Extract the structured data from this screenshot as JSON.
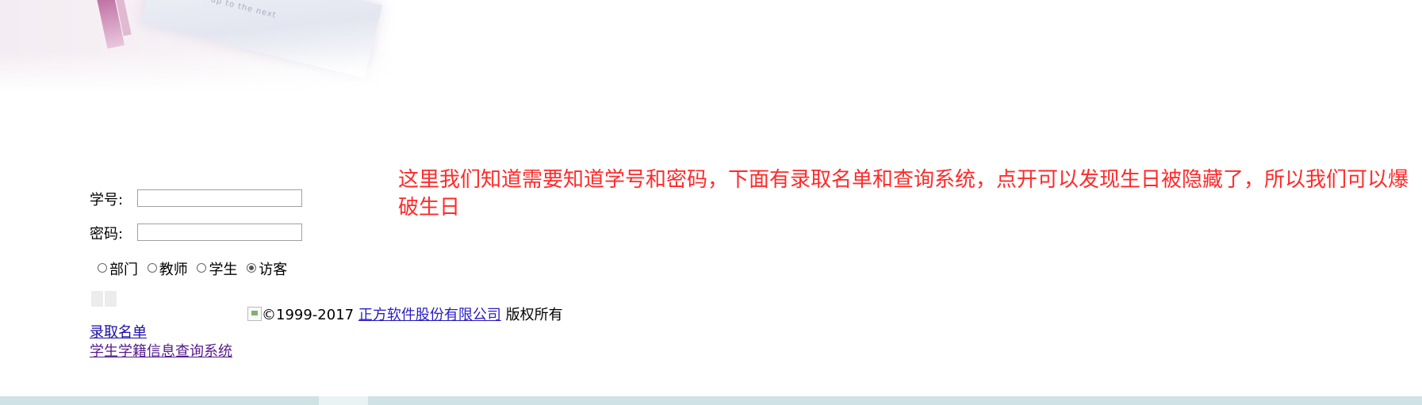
{
  "login": {
    "id_label": "学号:",
    "id_value": "",
    "password_label": "密码:",
    "password_value": "",
    "roles": [
      {
        "label": "部门",
        "selected": false
      },
      {
        "label": "教师",
        "selected": false
      },
      {
        "label": "学生",
        "selected": false
      },
      {
        "label": "访客",
        "selected": true
      }
    ]
  },
  "annotation": "这里我们知道需要知道学号和密码，下面有录取名单和查询系统，点开可以发现生日被隐藏了，所以我们可以爆破生日",
  "footer": {
    "copyright": "©1999-2017 ",
    "company_link": "正方软件股份有限公司",
    "rights": " 版权所有"
  },
  "links": {
    "admission_list": "录取名单",
    "student_info_system": "学生学籍信息查询系统"
  },
  "banner": {
    "paper_text": "...and up to the next"
  },
  "colors": {
    "annotation": "#ff2a2a",
    "link": "#1a0dab",
    "visited_link": "#551a8b",
    "bottom_bar": "#cfe2e5"
  }
}
